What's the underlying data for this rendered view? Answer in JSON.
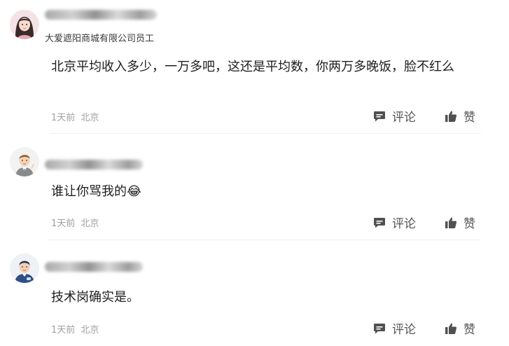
{
  "comments": [
    {
      "subtitle": "大爱遮阳商城有限公司员工",
      "text": "北京平均收入多少，一万多吧，这还是平均数，你两万多晚饭，脸不红么",
      "time": "1天前",
      "location": "北京",
      "reply_label": "评论",
      "like_label": "赞",
      "avatar_icon": "woman-avatar"
    },
    {
      "subtitle": "",
      "text": "谁让你骂我的😂",
      "time": "1天前",
      "location": "北京",
      "reply_label": "评论",
      "like_label": "赞",
      "avatar_icon": "man-suit-avatar"
    },
    {
      "subtitle": "",
      "text": "技术岗确实是。",
      "time": "1天前",
      "location": "北京",
      "reply_label": "评论",
      "like_label": "赞",
      "avatar_icon": "man-blue-avatar"
    }
  ],
  "colors": {
    "text": "#1e1e1e",
    "meta": "#a0a0a0",
    "action": "#555555",
    "divider": "#efefef"
  }
}
